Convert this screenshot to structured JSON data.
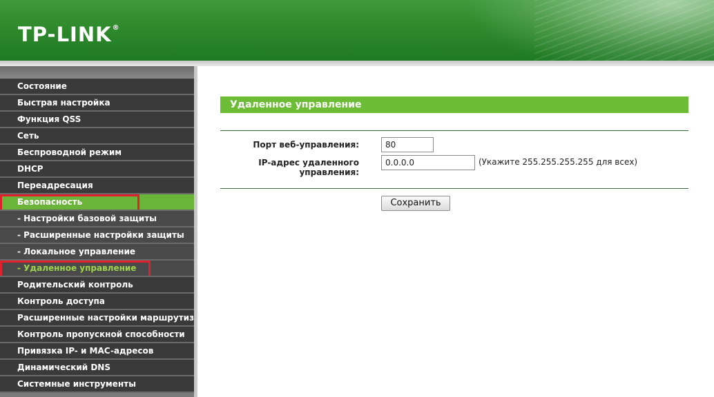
{
  "header": {
    "logo": "TP-LINK",
    "logo_mark": "®"
  },
  "sidebar": {
    "items": [
      {
        "label": "Состояние",
        "type": "main"
      },
      {
        "label": "Быстрая настройка",
        "type": "main"
      },
      {
        "label": "Функция QSS",
        "type": "main"
      },
      {
        "label": "Сеть",
        "type": "main"
      },
      {
        "label": "Беспроводной режим",
        "type": "main"
      },
      {
        "label": "DHCP",
        "type": "main"
      },
      {
        "label": "Переадресация",
        "type": "main"
      },
      {
        "label": "Безопасность",
        "type": "main",
        "state": "active",
        "highlighted": true
      },
      {
        "label": "- Настройки базовой защиты",
        "type": "sub"
      },
      {
        "label": "- Расширенные настройки защиты",
        "type": "sub"
      },
      {
        "label": "- Локальное управление",
        "type": "sub"
      },
      {
        "label": "- Удаленное управление",
        "type": "sub",
        "state": "selected",
        "highlighted": true
      },
      {
        "label": "Родительский контроль",
        "type": "main"
      },
      {
        "label": "Контроль доступа",
        "type": "main"
      },
      {
        "label": "Расширенные настройки маршрутизации",
        "type": "main"
      },
      {
        "label": "Контроль пропускной способности",
        "type": "main"
      },
      {
        "label": "Привязка IP- и MAC-адресов",
        "type": "main"
      },
      {
        "label": "Динамический DNS",
        "type": "main"
      },
      {
        "label": "Системные инструменты",
        "type": "main"
      }
    ]
  },
  "main": {
    "title": "Удаленное управление",
    "fields": {
      "port_label": "Порт веб-управления:",
      "port_value": "80",
      "ip_label": "IP-адрес удаленного управления:",
      "ip_value": "0.0.0.0",
      "ip_hint": "(Укажите 255.255.255.255 для всех)"
    },
    "save_label": "Сохранить"
  },
  "colors": {
    "header_green": "#2f8a2c",
    "accent_green": "#6cbd35",
    "menu_dark": "#3a3a3a",
    "highlight_red": "#e0212b",
    "selected_text": "#9fd54b"
  }
}
